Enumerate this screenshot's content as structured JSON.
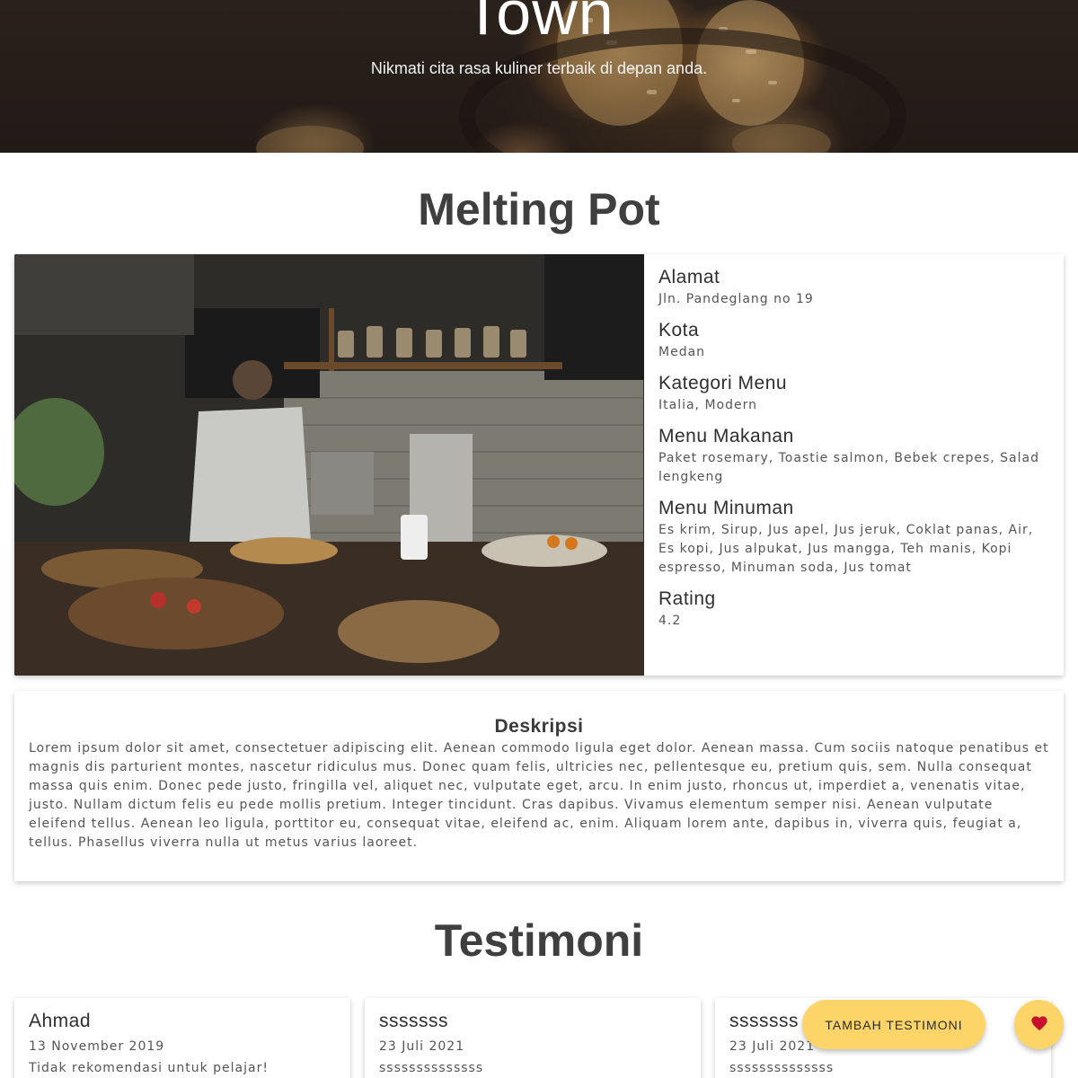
{
  "hero": {
    "title": "Town",
    "subtitle": "Nikmati cita rasa kuliner terbaik di depan anda."
  },
  "restaurant": {
    "name": "Melting Pot",
    "details": [
      {
        "label": "Alamat",
        "value": "Jln. Pandeglang no 19"
      },
      {
        "label": "Kota",
        "value": "Medan"
      },
      {
        "label": "Kategori Menu",
        "value": "Italia, Modern"
      },
      {
        "label": "Menu Makanan",
        "value": "Paket rosemary, Toastie salmon, Bebek crepes, Salad lengkeng"
      },
      {
        "label": "Menu Minuman",
        "value": "Es krim, Sirup, Jus apel, Jus jeruk, Coklat panas, Air, Es kopi, Jus alpukat, Jus mangga, Teh manis, Kopi espresso, Minuman soda, Jus tomat"
      },
      {
        "label": "Rating",
        "value": "4.2"
      }
    ],
    "description": {
      "title": "Deskripsi",
      "text": "Lorem ipsum dolor sit amet, consectetuer adipiscing elit. Aenean commodo ligula eget dolor. Aenean massa. Cum sociis natoque penatibus et magnis dis parturient montes, nascetur ridiculus mus. Donec quam felis, ultricies nec, pellentesque eu, pretium quis, sem. Nulla consequat massa quis enim. Donec pede justo, fringilla vel, aliquet nec, vulputate eget, arcu. In enim justo, rhoncus ut, imperdiet a, venenatis vitae, justo. Nullam dictum felis eu pede mollis pretium. Integer tincidunt. Cras dapibus. Vivamus elementum semper nisi. Aenean vulputate eleifend tellus. Aenean leo ligula, porttitor eu, consequat vitae, eleifend ac, enim. Aliquam lorem ante, dapibus in, viverra quis, feugiat a, tellus. Phasellus viverra nulla ut metus varius laoreet."
    }
  },
  "testimonials": {
    "title": "Testimoni",
    "items": [
      {
        "name": "Ahmad",
        "date": "13 November 2019",
        "text": "Tidak rekomendasi untuk pelajar!"
      },
      {
        "name": "sssssss",
        "date": "23 Juli 2021",
        "text": "ssssssssssssss"
      },
      {
        "name": "sssssss",
        "date": "23 Juli 2021",
        "text": "ssssssssssssss"
      }
    ]
  },
  "actions": {
    "add_testimonial_label": "TAMBAH TESTIMONI",
    "favorite_icon": "heart-icon",
    "accent_color": "#fdd467",
    "heart_color": "#c8102e"
  }
}
